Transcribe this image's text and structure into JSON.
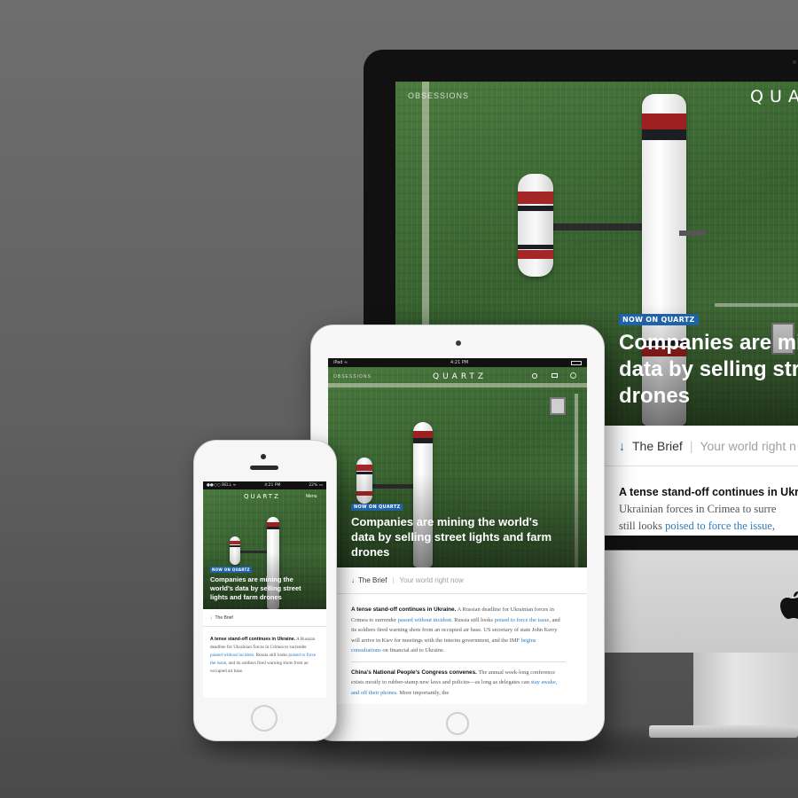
{
  "brand": {
    "accent": "#1f62a8",
    "link": "#2c7bbf"
  },
  "imac": {
    "nav_left": "OBSESSIONS",
    "logo": "QUA",
    "badge": "NOW ON QUARTZ",
    "headline_l1": "Companies are mi",
    "headline_l2": "data by selling str",
    "headline_l3": "drones",
    "brief_label": "The Brief",
    "brief_tagline": "Your world right n",
    "lead": "A tense stand-off continues in Ukra",
    "line1": "Ukrainian forces in Crimea to surre",
    "line2_a": "still looks ",
    "line2_link": "poised to force the issue",
    "line2_b": ", "
  },
  "ipad": {
    "status_left": "iPad ≈",
    "status_time": "4:21 PM",
    "nav_left": "OBSESSIONS",
    "logo": "QUARTZ",
    "badge": "NOW ON QUARTZ",
    "headline": "Companies are mining the world's data by selling street lights and farm drones",
    "brief_label": "The Brief",
    "brief_tagline": "Your world right now",
    "p1_lead": "A tense stand-off continues in Ukraine.",
    "p1_a": " A Russian deadline for Ukrainian forces in Crimea to surrender ",
    "p1_link1": "passed without incident",
    "p1_b": ". Russia still looks ",
    "p1_link2": "poised to force the issue",
    "p1_c": ", and its soldiers fired warning shots from an occupied air base. US secretary of state John Kerry will arrive in Kiev for meetings with the interim government, and the IMF ",
    "p1_link3": "begins consultations",
    "p1_d": " on financial aid to Ukraine.",
    "p2_lead": "China's National People's Congress convenes.",
    "p2_a": " The annual week-long conference exists mostly to rubber-stamp new laws and policies—as long as delegates can ",
    "p2_link": "stay awake, and off their phones",
    "p2_b": ". More importantly, the"
  },
  "iphone": {
    "status_left": "●●○○ BELL ≈",
    "status_time": "4:21 PM",
    "status_right": "22% ▭",
    "logo": "QUARTZ",
    "menu": "Menu",
    "badge": "NOW ON QUARTZ",
    "headline": "Companies are mining the world's data by selling street lights and farm drones",
    "brief_label": "The Brief",
    "p_lead": "A tense stand-off continues in Ukraine.",
    "p_a": " A Russian deadline for Ukrainian forces in Crimea to surrender ",
    "p_link1": "passed without incident",
    "p_b": ". Russia still looks ",
    "p_link2": "poised to force the issue",
    "p_c": ", and its soldiers fired warning shots from an occupied air base."
  }
}
